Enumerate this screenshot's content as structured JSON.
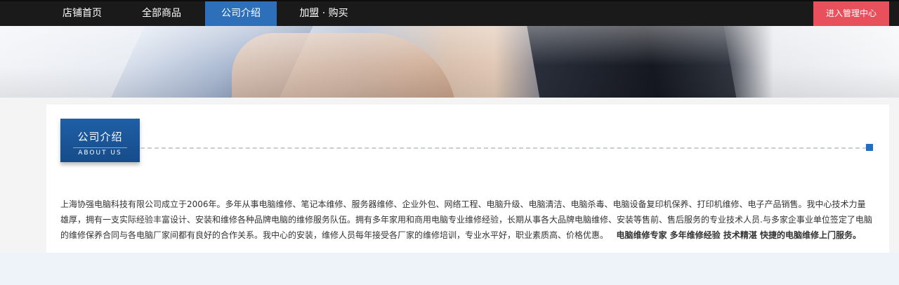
{
  "nav": {
    "items": [
      {
        "label": "店铺首页"
      },
      {
        "label": "全部商品"
      },
      {
        "label": "公司介绍"
      },
      {
        "label": "加盟 · 购买"
      }
    ],
    "admin_label": "进入管理中心"
  },
  "section": {
    "title_zh": "公司介绍",
    "title_en": "ABOUT US"
  },
  "intro": {
    "text": "上海协强电脑科技有限公司成立于2006年。多年从事电脑维修、笔记本维修、服务器维修、企业外包、网络工程、电脑升级、电脑清洁、电脑杀毒、电脑设备复印机保养、打印机维修、电子产品销售。我中心技术力量雄厚，拥有一支实际经验丰富设计、安装和维修各种品牌电脑的维修服务队伍。拥有多年家用和商用电脑专业维修经验，长期从事各大品牌电脑维修、安装等售前、售后服务的专业技术人员.与多家企事业单位签定了电脑的维修保养合同与各电脑厂家间都有良好的合作关系。我中心的安装，维修人员每年接受各厂家的维修培训，专业水平好，职业素质高、价格优惠。",
    "slogan": "电脑维修专家 多年维修经验 技术精湛 快捷的电脑维修上门服务。"
  },
  "colors": {
    "nav_bg": "#1a1a1a",
    "nav_active": "#2d6fb8",
    "admin_button": "#e8505b",
    "badge": "#1f5fa6"
  }
}
